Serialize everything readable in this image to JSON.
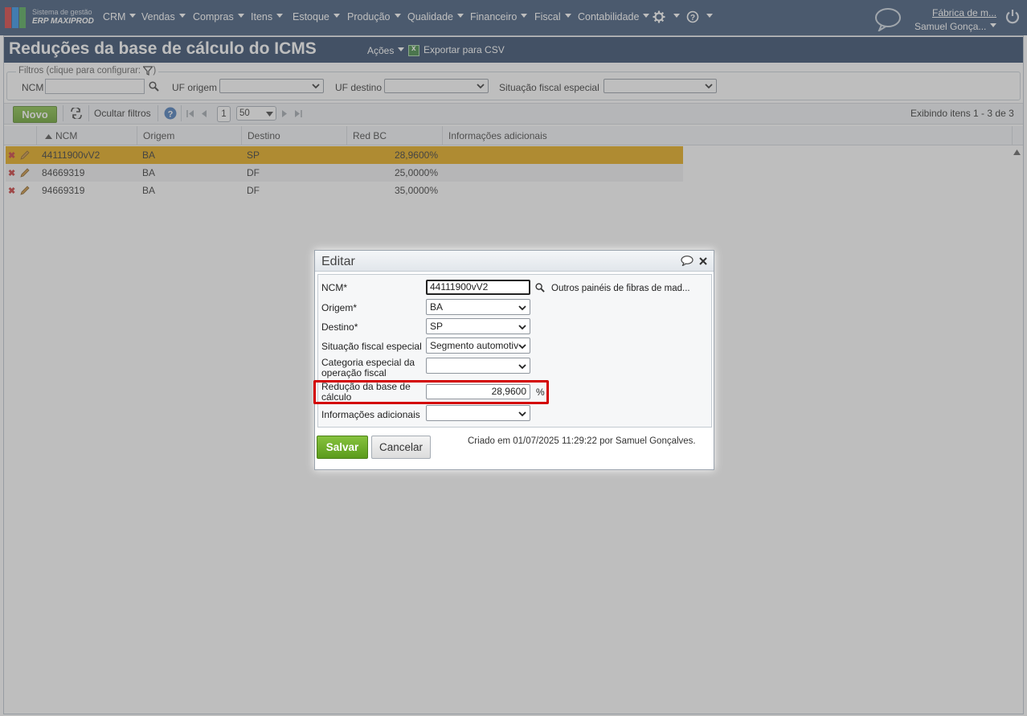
{
  "app": {
    "logo_line1": "Sistema de gestão",
    "logo_line2": "ERP MAXIPROD",
    "company": "Fábrica de m...",
    "user": "Samuel Gonça..."
  },
  "nav": [
    "CRM",
    "Vendas",
    "Compras",
    "Itens",
    "Estoque",
    "Produção",
    "Qualidade",
    "Financeiro",
    "Fiscal",
    "Contabilidade"
  ],
  "page": {
    "title": "Reduções da base de cálculo do ICMS",
    "actions_label": "Ações",
    "export_label": "Exportar para CSV"
  },
  "filters": {
    "legend": "Filtros (clique para configurar:",
    "legend_close": ")",
    "ncm_label": "NCM",
    "uf_origem_label": "UF origem",
    "uf_destino_label": "UF destino",
    "situacao_label": "Situação fiscal especial"
  },
  "toolbar": {
    "new_label": "Novo",
    "hide_filters_label": "Ocultar filtros",
    "page_number": "1",
    "page_size": "50",
    "items_info": "Exibindo itens 1 - 3 de 3"
  },
  "grid": {
    "columns": [
      "NCM",
      "Origem",
      "Destino",
      "Red BC",
      "Informações adicionais"
    ],
    "rows": [
      {
        "ncm": "44111900vV2",
        "origem": "BA",
        "destino": "SP",
        "red_bc": "28,9600%",
        "info": ""
      },
      {
        "ncm": "84669319",
        "origem": "BA",
        "destino": "DF",
        "red_bc": "25,0000%",
        "info": ""
      },
      {
        "ncm": "94669319",
        "origem": "BA",
        "destino": "DF",
        "red_bc": "35,0000%",
        "info": ""
      }
    ]
  },
  "modal": {
    "title": "Editar",
    "ncm_label": "NCM*",
    "ncm_value": "44111900vV2",
    "ncm_description": "Outros painéis de fibras de mad...",
    "origem_label": "Origem*",
    "origem_value": "BA",
    "destino_label": "Destino*",
    "destino_value": "SP",
    "situacao_label": "Situação fiscal especial",
    "situacao_value": "Segmento automotivo",
    "categoria_label_1": "Categoria especial da",
    "categoria_label_2": "operação fiscal",
    "categoria_value": "",
    "reducao_label_1": "Redução da base de",
    "reducao_label_2": "cálculo",
    "reducao_value": "28,9600",
    "reducao_unit": "%",
    "info_label": "Informações adicionais",
    "info_value": "",
    "save_label": "Salvar",
    "cancel_label": "Cancelar",
    "created_text": "Criado em 01/07/2025 11:29:22 por Samuel Gonçalves."
  },
  "colors": {
    "nav_bg": "#2f4a6d",
    "title_bg": "#1f3a5e",
    "selected_row": "#e3a300",
    "save_green": "#5b9b1c",
    "highlight_red": "#d30000"
  }
}
